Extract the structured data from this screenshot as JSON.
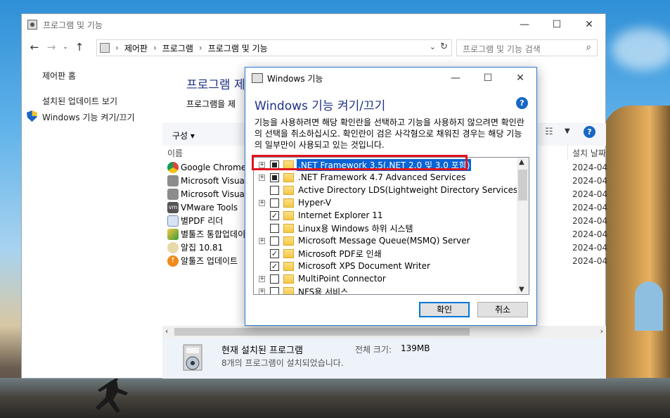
{
  "explorer": {
    "title": "프로그램 및 기능",
    "breadcrumb": [
      "제어판",
      "프로그램",
      "프로그램 및 기능"
    ],
    "search_placeholder": "프로그램 및 기능 검색",
    "left_links": [
      "제어판 홈",
      "설치된 업데이트 보기",
      "Windows 기능 켜기/끄기"
    ],
    "main_title": "프로그램 제",
    "main_desc": "프로그램을 제",
    "organize": "구성 ▾",
    "columns": {
      "name": "이름",
      "date": "설치 날짜"
    },
    "programs": [
      {
        "name": "Google Chrome",
        "date": "2024-04"
      },
      {
        "name": "Microsoft Visual",
        "date": "2024-04"
      },
      {
        "name": "Microsoft Visual",
        "date": "2024-04"
      },
      {
        "name": "VMware Tools",
        "date": "2024-04"
      },
      {
        "name": "별PDF 리더",
        "date": "2024-04"
      },
      {
        "name": "별툴즈 통합업데이",
        "date": "2024-04"
      },
      {
        "name": "알집 10.81",
        "date": "2024-04"
      },
      {
        "name": "알툴즈 업데이트",
        "date": "2024-04"
      }
    ],
    "details": {
      "title": "현재 설치된 프로그램",
      "size_label": "전체 크기:",
      "size_value": "139MB",
      "count_text": "8개의 프로그램이 설치되었습니다."
    }
  },
  "dialog": {
    "title": "Windows 기능",
    "heading": "Windows 기능 켜기/끄기",
    "description": "기능을 사용하려면 해당 확인란을 선택하고 기능을 사용하지 않으려면 확인란의 선택을 취소하십시오. 확인란이 검은 사각형으로 채워진 경우는 해당 기능의 일부만이 사용되고 있는 것입니다.",
    "features": [
      {
        "label": ".NET Framework 3.5(.NET 2.0 및 3.0 포함)",
        "expandable": true,
        "state": "partial",
        "selected": true
      },
      {
        "label": ".NET Framework 4.7 Advanced Services",
        "expandable": true,
        "state": "partial",
        "selected": false
      },
      {
        "label": "Active Directory LDS(Lightweight Directory Services)",
        "expandable": false,
        "state": "unchecked",
        "selected": false
      },
      {
        "label": "Hyper-V",
        "expandable": true,
        "state": "unchecked",
        "selected": false
      },
      {
        "label": "Internet Explorer 11",
        "expandable": false,
        "state": "checked",
        "selected": false
      },
      {
        "label": "Linux용 Windows 하위 시스템",
        "expandable": false,
        "state": "unchecked",
        "selected": false
      },
      {
        "label": "Microsoft Message Queue(MSMQ) Server",
        "expandable": true,
        "state": "unchecked",
        "selected": false
      },
      {
        "label": "Microsoft PDF로 인쇄",
        "expandable": false,
        "state": "checked",
        "selected": false
      },
      {
        "label": "Microsoft XPS Document Writer",
        "expandable": false,
        "state": "checked",
        "selected": false
      },
      {
        "label": "MultiPoint Connector",
        "expandable": true,
        "state": "unchecked",
        "selected": false
      },
      {
        "label": "NFS용 서비스",
        "expandable": true,
        "state": "unchecked",
        "selected": false
      }
    ],
    "ok_label": "확인",
    "cancel_label": "취소"
  },
  "colors": {
    "accent": "#0078d7",
    "heading": "#1e3287",
    "highlight": "#e0141e",
    "selection": "#0a64d4"
  }
}
